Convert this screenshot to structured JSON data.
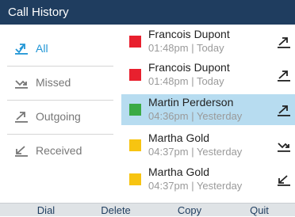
{
  "title": "Call History",
  "filters": [
    {
      "label": "All",
      "icon": "all-calls-icon",
      "active": true
    },
    {
      "label": "Missed",
      "icon": "missed-call-icon",
      "active": false
    },
    {
      "label": "Outgoing",
      "icon": "outgoing-call-icon",
      "active": false
    },
    {
      "label": "Received",
      "icon": "received-call-icon",
      "active": false
    }
  ],
  "calls": [
    {
      "name": "Francois Dupont",
      "time": "01:48pm",
      "day": "Today",
      "meta": "01:48pm | Today",
      "status": "missed",
      "color": "#e8202e",
      "direction_icon": "outgoing-call-icon",
      "selected": false
    },
    {
      "name": "Francois Dupont",
      "time": "01:48pm",
      "day": "Today",
      "meta": "01:48pm | Today",
      "status": "missed",
      "color": "#e8202e",
      "direction_icon": "outgoing-call-icon",
      "selected": false
    },
    {
      "name": "Martin Perderson",
      "time": "04:36pm",
      "day": "Yesterday",
      "meta": "04:36pm | Yesterday",
      "status": "answered",
      "color": "#3aaa44",
      "direction_icon": "outgoing-call-icon",
      "selected": true
    },
    {
      "name": "Martha Gold",
      "time": "04:37pm",
      "day": "Yesterday",
      "meta": "04:37pm | Yesterday",
      "status": "other",
      "color": "#f7c411",
      "direction_icon": "missed-call-icon",
      "selected": false
    },
    {
      "name": "Martha Gold",
      "time": "04:37pm",
      "day": "Yesterday",
      "meta": "04:37pm | Yesterday",
      "status": "other",
      "color": "#f7c411",
      "direction_icon": "received-call-icon",
      "selected": false
    }
  ],
  "softkeys": [
    "Dial",
    "Delete",
    "Copy",
    "Quit"
  ],
  "colors": {
    "header": "#1f3d5f",
    "accent": "#2196d6",
    "selected_row": "#b7dcf0",
    "softkey_bar": "#dfe3e6"
  }
}
